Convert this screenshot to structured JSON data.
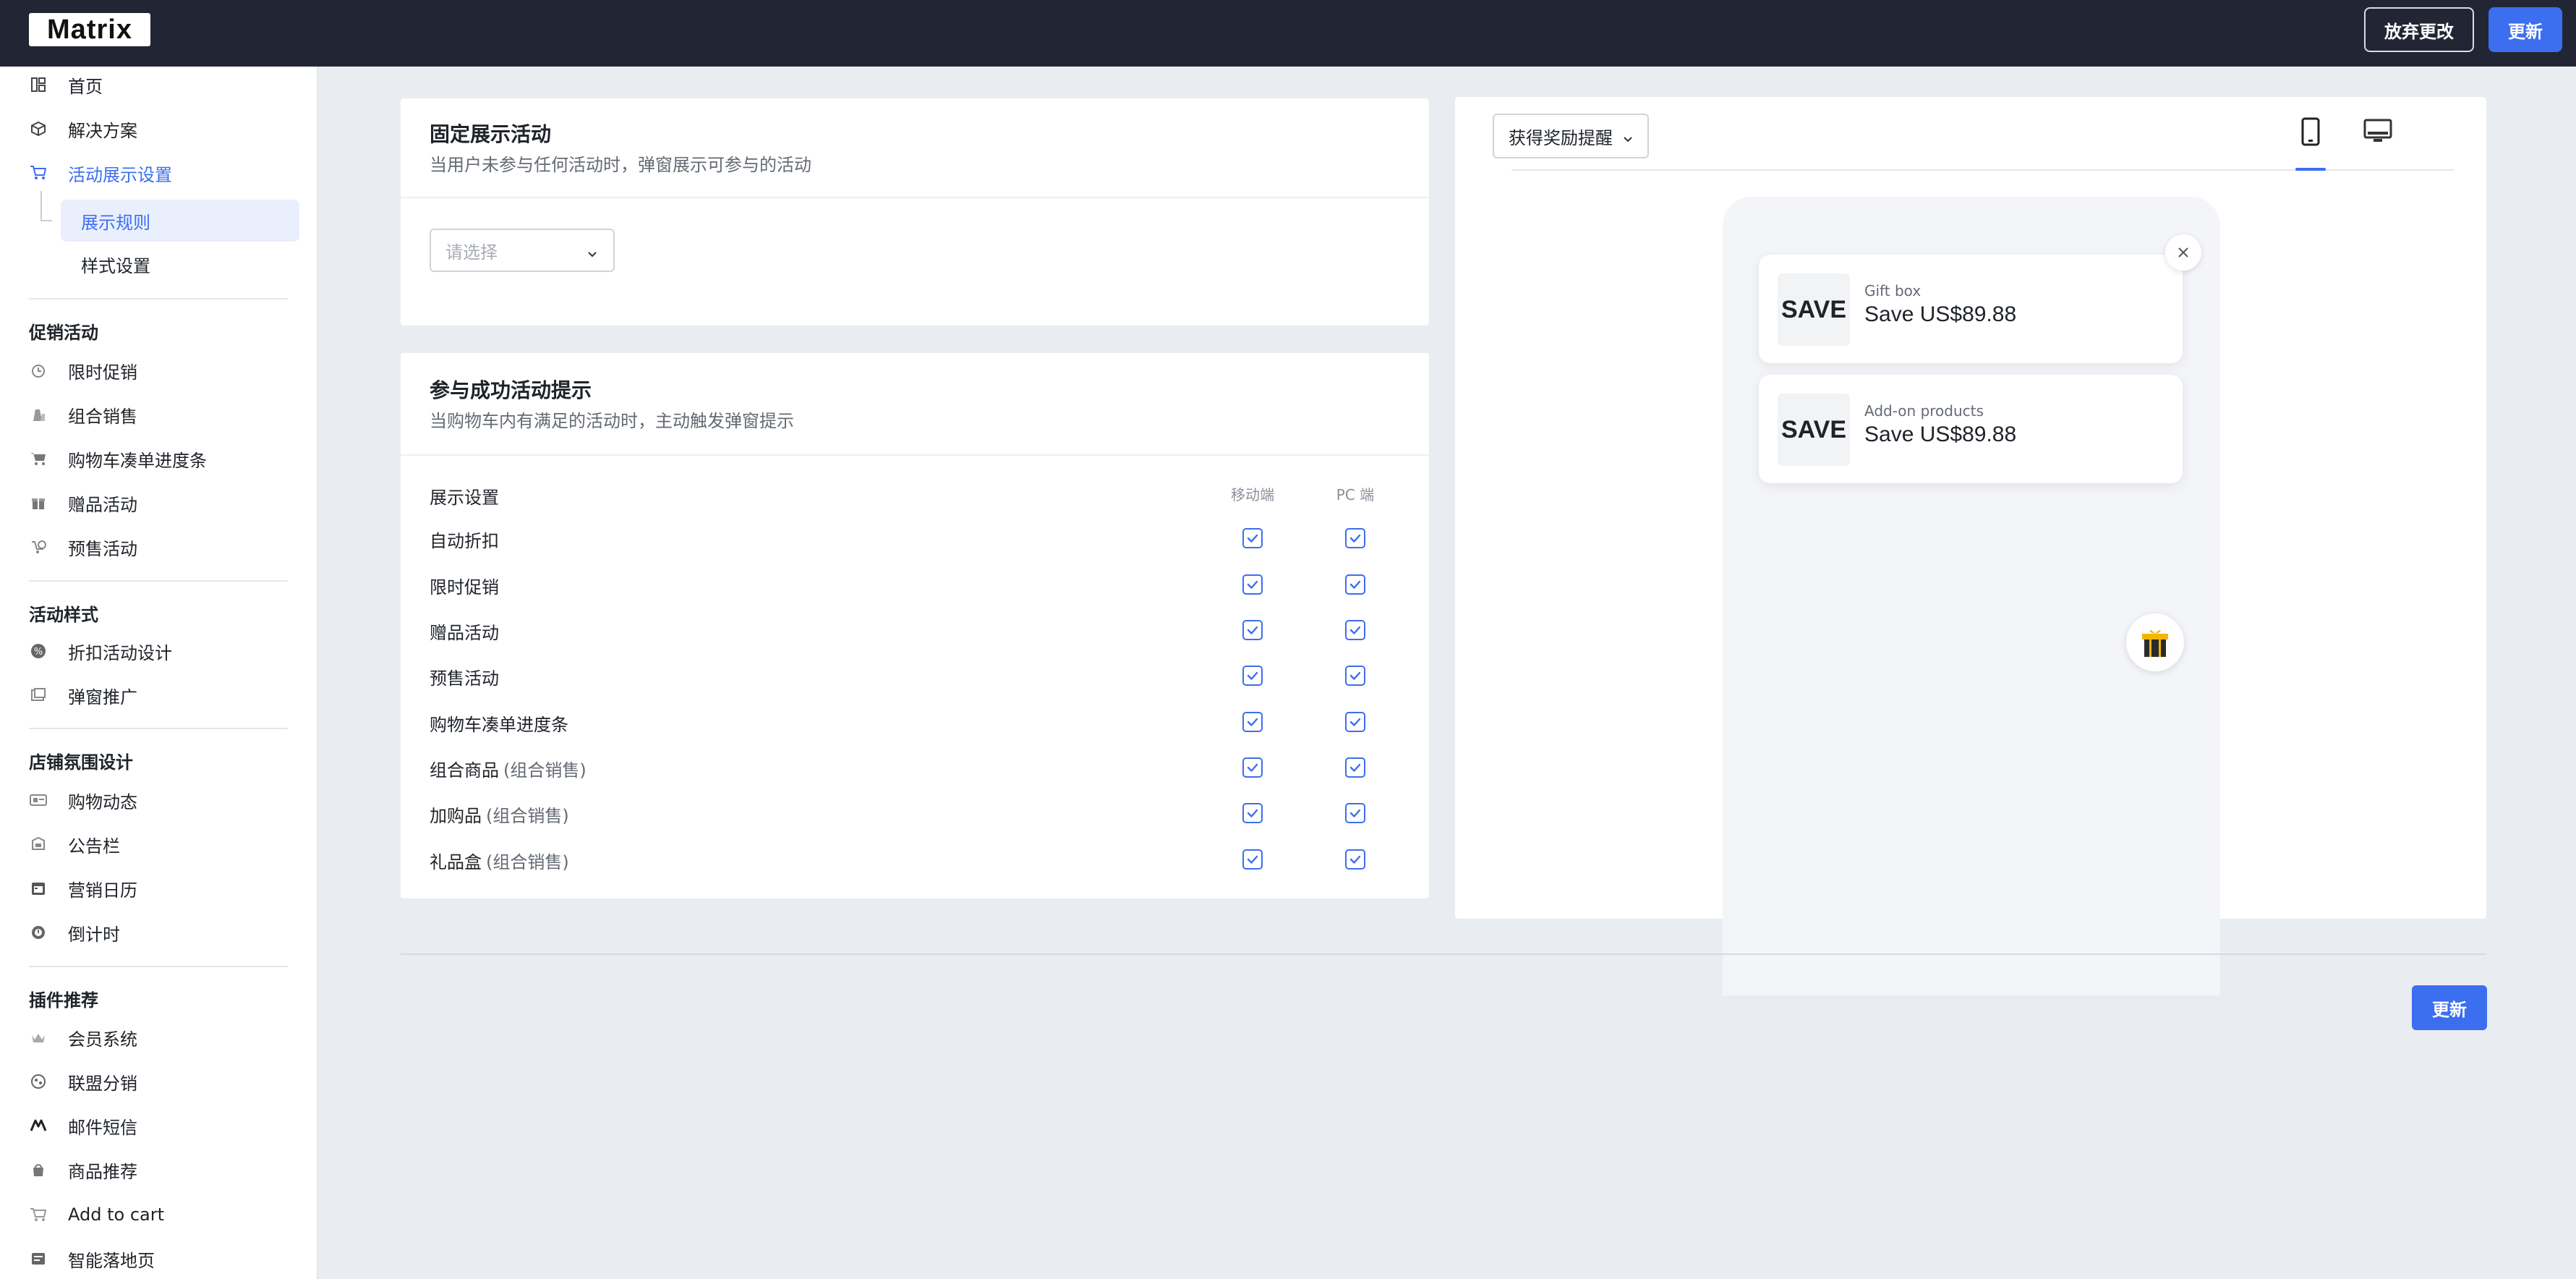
{
  "topbar": {
    "logo_text": "Matrix",
    "discard_label": "放弃更改",
    "update_label": "更新"
  },
  "sidebar": {
    "top_items": [
      {
        "label": "首页",
        "icon": "layout-icon"
      },
      {
        "label": "解决方案",
        "icon": "cube-icon"
      },
      {
        "label": "活动展示设置",
        "icon": "cart-icon",
        "active": true
      }
    ],
    "sub_items": [
      {
        "label": "展示规则",
        "active": true
      },
      {
        "label": "样式设置"
      }
    ],
    "sections": [
      {
        "title": "促销活动",
        "items": [
          {
            "label": "限时促销",
            "icon": "clock-icon"
          },
          {
            "label": "组合销售",
            "icon": "bundle-icon"
          },
          {
            "label": "购物车凑单进度条",
            "icon": "cart-progress-icon"
          },
          {
            "label": "赠品活动",
            "icon": "gift-icon"
          },
          {
            "label": "预售活动",
            "icon": "presale-icon"
          }
        ]
      },
      {
        "title": "活动样式",
        "items": [
          {
            "label": "折扣活动设计",
            "icon": "discount-icon"
          },
          {
            "label": "弹窗推广",
            "icon": "popup-icon"
          }
        ]
      },
      {
        "title": "店铺氛围设计",
        "items": [
          {
            "label": "购物动态",
            "icon": "activity-icon"
          },
          {
            "label": "公告栏",
            "icon": "announcement-icon"
          },
          {
            "label": "营销日历",
            "icon": "calendar-icon"
          },
          {
            "label": "倒计时",
            "icon": "countdown-icon"
          }
        ]
      },
      {
        "title": "插件推荐",
        "items": [
          {
            "label": "会员系统",
            "icon": "member-icon"
          },
          {
            "label": "联盟分销",
            "icon": "affiliate-icon"
          },
          {
            "label": "邮件短信",
            "icon": "mail-icon"
          },
          {
            "label": "商品推荐",
            "icon": "product-icon"
          },
          {
            "label": "Add to cart",
            "icon": "add-cart-icon"
          },
          {
            "label": "智能落地页",
            "icon": "landing-icon"
          }
        ]
      }
    ]
  },
  "fixed_card": {
    "title": "固定展示活动",
    "subtitle": "当用户未参与任何活动时，弹窗展示可参与的活动",
    "select_placeholder": "请选择"
  },
  "success_card": {
    "title": "参与成功活动提示",
    "subtitle": "当购物车内有满足的活动时，主动触发弹窗提示",
    "header_label": "展示设置",
    "col_mobile": "移动端",
    "col_pc": "PC 端",
    "rows": [
      {
        "label": "自动折扣",
        "note": "",
        "mobile": true,
        "pc": true
      },
      {
        "label": "限时促销",
        "note": "",
        "mobile": true,
        "pc": true
      },
      {
        "label": "赠品活动",
        "note": "",
        "mobile": true,
        "pc": true
      },
      {
        "label": "预售活动",
        "note": "",
        "mobile": true,
        "pc": true
      },
      {
        "label": "购物车凑单进度条",
        "note": "",
        "mobile": true,
        "pc": true
      },
      {
        "label": "组合商品",
        "note": "(组合销售)",
        "mobile": true,
        "pc": true
      },
      {
        "label": "加购品",
        "note": "(组合销售)",
        "mobile": true,
        "pc": true
      },
      {
        "label": "礼品盒",
        "note": "(组合销售)",
        "mobile": true,
        "pc": true
      }
    ]
  },
  "preview": {
    "dropdown_label": "获得奖励提醒",
    "active_device": "mobile",
    "cards": [
      {
        "badge": "SAVE",
        "title": "Gift box",
        "value": "Save US$89.88"
      },
      {
        "badge": "SAVE",
        "title": "Add-on products",
        "value": "Save US$89.88"
      }
    ]
  },
  "footer": {
    "update_label": "更新"
  },
  "colors": {
    "accent": "#3c6ef0",
    "topbar": "#222634",
    "background": "#e9ecf1"
  }
}
